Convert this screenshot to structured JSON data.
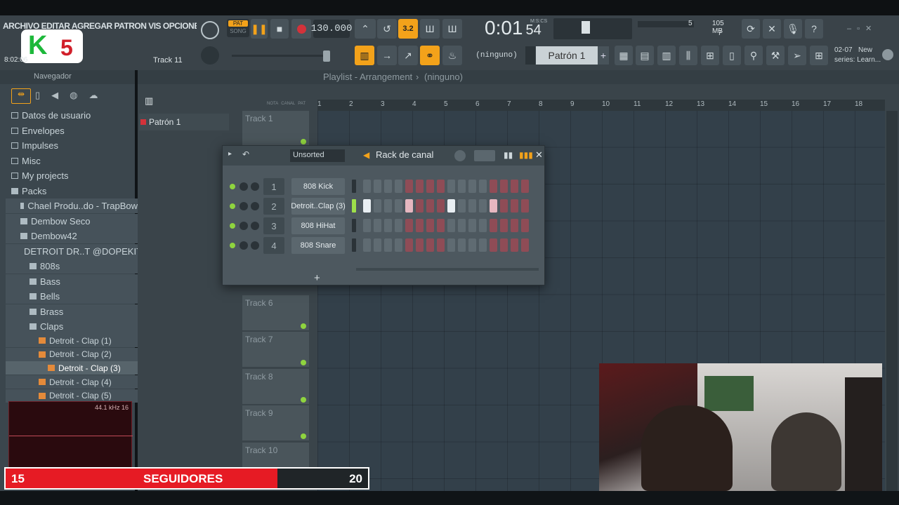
{
  "menu": {
    "text": "ARCHIVO EDITAR AGREGAR PATRON VIS OPCIONES HERRAMIENTA"
  },
  "topbar": {
    "time_small": "8:02:06",
    "track_hint": "Track 11",
    "pat_label": "PAT",
    "song_label": "SONG",
    "tempo": "130.000",
    "time": "0:01",
    "time_sub": "54",
    "time_unit": "M:S:CS",
    "cpu_value": "5",
    "mem_value": "105 MB",
    "voices": "7",
    "pattern_selector": "(ninguno)",
    "pattern_name": "Patrón 1",
    "news_date": "02-07",
    "news_title": "New",
    "news_text": "series: Learn..."
  },
  "browser": {
    "title": "Navegador",
    "items": [
      {
        "label": "Datos de usuario",
        "indent": 0,
        "icon": "folder"
      },
      {
        "label": "Envelopes",
        "indent": 0,
        "icon": "folder"
      },
      {
        "label": "Impulses",
        "indent": 0,
        "icon": "folder"
      },
      {
        "label": "Misc",
        "indent": 0,
        "icon": "folder"
      },
      {
        "label": "My projects",
        "indent": 0,
        "icon": "folder"
      },
      {
        "label": "Packs",
        "indent": 0,
        "icon": "folder-open"
      },
      {
        "label": "Chael Produ..do - TrapBow",
        "indent": 1,
        "icon": "folder-open"
      },
      {
        "label": "Dembow Seco",
        "indent": 1,
        "icon": "folder-open"
      },
      {
        "label": "Dembow42",
        "indent": 1,
        "icon": "folder-open"
      },
      {
        "label": "DETROIT DR..T @DOPEKIT",
        "indent": 1,
        "icon": "folder-open"
      },
      {
        "label": "808s",
        "indent": 2,
        "icon": "folder-open"
      },
      {
        "label": "Bass",
        "indent": 2,
        "icon": "folder-open"
      },
      {
        "label": "Bells",
        "indent": 2,
        "icon": "folder-open"
      },
      {
        "label": "Brass",
        "indent": 2,
        "icon": "folder-open"
      },
      {
        "label": "Claps",
        "indent": 2,
        "icon": "folder-open"
      },
      {
        "label": "Detroit - Clap (1)",
        "indent": 3,
        "icon": "audio-file"
      },
      {
        "label": "Detroit - Clap (2)",
        "indent": 3,
        "icon": "audio-file"
      },
      {
        "label": "Detroit - Clap (3)",
        "indent": 3,
        "icon": "audio-file"
      },
      {
        "label": "Detroit - Clap (4)",
        "indent": 3,
        "icon": "audio-file"
      },
      {
        "label": "Detroit - Clap (5)",
        "indent": 3,
        "icon": "audio-file"
      }
    ],
    "sample_info": "44.1 kHz 16"
  },
  "playlist": {
    "title": "Playlist - Arrangement",
    "breadcrumb_sep": "›",
    "pattern_sel": "(ninguno)",
    "pattern_item": "Patrón 1",
    "ruler": [
      "1",
      "2",
      "3",
      "4",
      "5",
      "6",
      "7",
      "8",
      "9",
      "10",
      "11",
      "12",
      "13",
      "14",
      "15",
      "16",
      "17",
      "18"
    ],
    "tracks": [
      "Track 1",
      "Track 6",
      "Track 7",
      "Track 8",
      "Track 9",
      "Track 10"
    ],
    "tiny_labels": [
      "NOTA",
      "CANAL",
      "PAT"
    ]
  },
  "rack": {
    "sort": "Unsorted",
    "title": "Rack de canal",
    "channels": [
      {
        "num": "1",
        "name": "808 Kick",
        "steps": []
      },
      {
        "num": "2",
        "name": "Detroit..Clap (3)",
        "steps": [
          0,
          4,
          8,
          12
        ]
      },
      {
        "num": "3",
        "name": "808 HiHat",
        "steps": []
      },
      {
        "num": "4",
        "name": "808 Snare",
        "steps": []
      }
    ],
    "add_label": "+"
  },
  "overlay": {
    "logo_k": "K",
    "logo_5": "5",
    "follow_left": "15",
    "follow_label": "SEGUIDORES",
    "follow_right": "20",
    "follow_progress": 0.75
  },
  "colors": {
    "accent": "#f3a21a",
    "steps_red": "#8f4c56",
    "steps_grey": "#5f6b72",
    "step_on": "#e8eef2",
    "follow_red": "#e61b24"
  }
}
